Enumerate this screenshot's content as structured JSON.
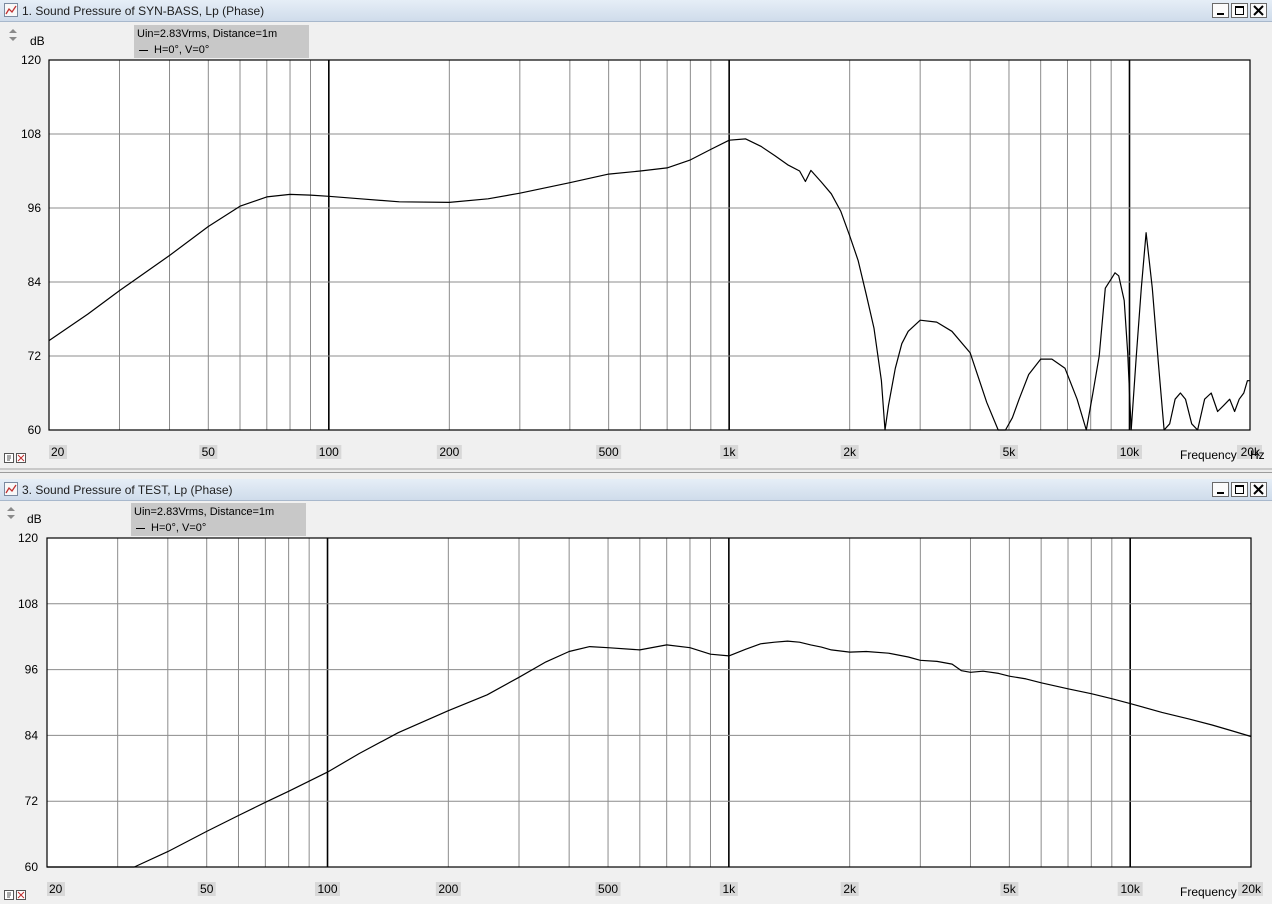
{
  "windows": [
    {
      "title": "1. Sound Pressure of SYN-BASS, Lp (Phase)",
      "legend": {
        "line1": "Uin=2.83Vrms, Distance=1m",
        "line2": "H=0°, V=0°"
      },
      "y_unit": "dB",
      "x_unit": "Hz",
      "x_name": "Frequency"
    },
    {
      "title": "3. Sound Pressure of TEST, Lp (Phase)",
      "legend": {
        "line1": "Uin=2.83Vrms, Distance=1m",
        "line2": "H=0°, V=0°"
      },
      "y_unit": "dB",
      "x_unit": "Hz",
      "x_name": "Frequency"
    }
  ],
  "icons": [
    "chart-icon",
    "minimize-icon",
    "maximize-icon",
    "close-icon",
    "scroll-arrows-icon",
    "plot-settings-icon"
  ],
  "colors": {
    "curve": "#000000",
    "plot_bg": "#ffffff",
    "grid": "#8c8c8c",
    "legend_bg": "#c8c8c8"
  },
  "chart_data": [
    {
      "type": "line",
      "title": "1. Sound Pressure of SYN-BASS, Lp (Phase)",
      "xlabel": "Frequency",
      "x_unit": "Hz",
      "ylabel": "dB",
      "xscale": "log",
      "xlim": [
        20,
        20000
      ],
      "ylim": [
        60,
        120
      ],
      "x_ticks": [
        "20",
        "50",
        "100",
        "200",
        "500",
        "1k",
        "2k",
        "5k",
        "10k",
        "20k"
      ],
      "y_ticks": [
        "120",
        "108",
        "96",
        "84",
        "72",
        "60"
      ],
      "grid": true,
      "series": [
        {
          "name": "H=0°, V=0°",
          "x": [
            20,
            25,
            30,
            40,
            50,
            60,
            70,
            80,
            90,
            100,
            120,
            150,
            200,
            250,
            300,
            400,
            500,
            600,
            700,
            800,
            900,
            1000,
            1100,
            1200,
            1300,
            1400,
            1500,
            1550,
            1600,
            1700,
            1800,
            1900,
            2000,
            2100,
            2200,
            2300,
            2400,
            2450,
            2500,
            2600,
            2700,
            2800,
            3000,
            3300,
            3600,
            4000,
            4400,
            4700,
            4900,
            5100,
            5300,
            5600,
            6000,
            6400,
            6900,
            7400,
            7800,
            8100,
            8400,
            8700,
            9000,
            9200,
            9400,
            9700,
            9900,
            10100,
            10400,
            10700,
            11000,
            11400,
            11800,
            12200,
            12600,
            13000,
            13400,
            13800,
            14300,
            14800,
            15400,
            16000,
            16600,
            17200,
            17800,
            18300,
            18800,
            19300,
            19700,
            20000
          ],
          "y": [
            74.5,
            78.8,
            82.6,
            88.3,
            93.0,
            96.3,
            97.8,
            98.2,
            98.1,
            97.9,
            97.5,
            97.0,
            96.9,
            97.5,
            98.4,
            100.1,
            101.5,
            102.0,
            102.5,
            103.8,
            105.5,
            107.0,
            107.2,
            106.0,
            104.5,
            103.0,
            102.0,
            100.3,
            102.1,
            100.2,
            98.3,
            95.5,
            91.5,
            87.5,
            82.0,
            76.5,
            68.0,
            60.0,
            64.0,
            70.0,
            74.0,
            76.0,
            77.8,
            77.5,
            76.0,
            72.5,
            64.5,
            60.0,
            60.0,
            62.0,
            65.0,
            69.0,
            71.5,
            71.5,
            70.0,
            65.0,
            60.0,
            66.0,
            72.0,
            83.0,
            84.5,
            85.5,
            85.0,
            81.0,
            72.5,
            60.0,
            72.0,
            83.0,
            92.0,
            83.0,
            71.0,
            60.0,
            61.0,
            65.0,
            66.0,
            65.0,
            61.0,
            60.0,
            65.0,
            66.0,
            63.0,
            64.0,
            65.0,
            63.0,
            65.0,
            66.0,
            68.0,
            68.0
          ]
        }
      ]
    },
    {
      "type": "line",
      "title": "3. Sound Pressure of TEST, Lp (Phase)",
      "xlabel": "Frequency",
      "x_unit": "Hz",
      "ylabel": "dB",
      "xscale": "log",
      "xlim": [
        20,
        20000
      ],
      "ylim": [
        60,
        120
      ],
      "x_ticks": [
        "20",
        "50",
        "100",
        "200",
        "500",
        "1k",
        "2k",
        "5k",
        "10k",
        "20k"
      ],
      "y_ticks": [
        "120",
        "108",
        "96",
        "84",
        "72",
        "60"
      ],
      "grid": true,
      "series": [
        {
          "name": "H=0°, V=0°",
          "x": [
            20,
            25,
            30,
            33,
            40,
            50,
            60,
            70,
            80,
            100,
            120,
            150,
            200,
            250,
            300,
            350,
            400,
            450,
            500,
            600,
            700,
            800,
            900,
            1000,
            1100,
            1200,
            1300,
            1400,
            1500,
            1600,
            1700,
            1800,
            2000,
            2200,
            2500,
            2800,
            3000,
            3300,
            3600,
            3800,
            4000,
            4300,
            4700,
            5000,
            5500,
            6000,
            7000,
            8000,
            9000,
            10000,
            12000,
            14000,
            16000,
            18000,
            20000
          ],
          "y": [
            60,
            60,
            60,
            60,
            62.8,
            66.5,
            69.4,
            71.8,
            73.8,
            77.3,
            80.7,
            84.5,
            88.5,
            91.4,
            94.6,
            97.4,
            99.3,
            100.2,
            100.0,
            99.6,
            100.5,
            100.0,
            98.8,
            98.5,
            99.7,
            100.7,
            101.0,
            101.2,
            101.0,
            100.5,
            100.1,
            99.6,
            99.2,
            99.3,
            99.0,
            98.3,
            97.7,
            97.5,
            97.0,
            95.8,
            95.5,
            95.7,
            95.3,
            94.8,
            94.3,
            93.6,
            92.5,
            91.6,
            90.7,
            89.8,
            88.2,
            87.0,
            85.9,
            84.8,
            83.8
          ]
        }
      ]
    }
  ]
}
